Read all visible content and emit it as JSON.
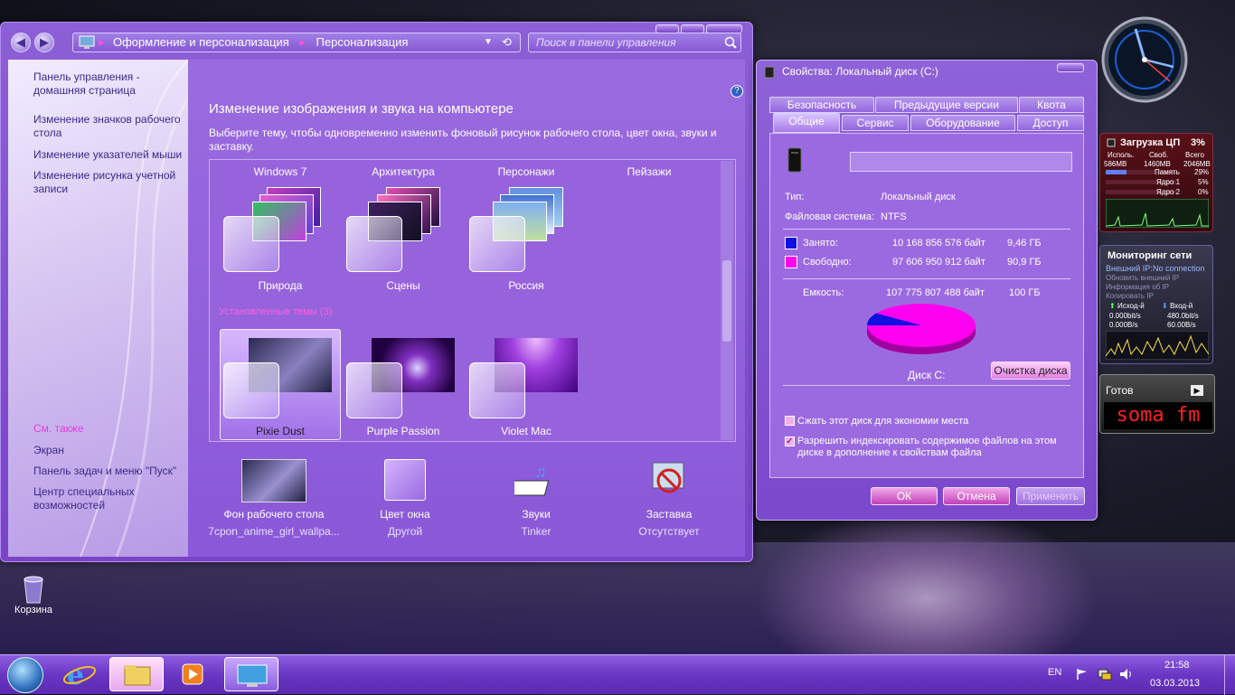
{
  "main_window": {
    "address_parts": [
      "Оформление и персонализация",
      "Персонализация"
    ],
    "search_placeholder": "Поиск в панели управления",
    "help_glyph": "?",
    "left_links": [
      "Панель управления - домашняя страница",
      "Изменение значков рабочего стола",
      "Изменение указателей мыши",
      "Изменение рисунка учетной записи"
    ],
    "see_also_heading": "См. также",
    "see_also_links": [
      "Экран",
      "Панель задач и меню \"Пуск\"",
      "Центр специальных возможностей"
    ],
    "heading": "Изменение изображения и звука на компьютере",
    "description": "Выберите тему, чтобы одновременно изменить фоновый рисунок рабочего стола, цвет окна, звуки и заставку.",
    "category_labels": [
      "Windows 7",
      "Архитектура",
      "Персонажи",
      "Пейзажи"
    ],
    "aero_themes": [
      "Природа",
      "Сцены",
      "Россия"
    ],
    "installed_heading": "Установленные темы (3)",
    "installed_themes": [
      "Pixie Dust",
      "Purple Passion",
      "Violet Mac"
    ],
    "selected_theme": "Pixie Dust",
    "bottom_items": [
      {
        "label": "Фон рабочего стола",
        "value": "7cpon_anime_girl_wallpa..."
      },
      {
        "label": "Цвет окна",
        "value": "Другой"
      },
      {
        "label": "Звуки",
        "value": "Tinker"
      },
      {
        "label": "Заставка",
        "value": "Отсутствует"
      }
    ]
  },
  "properties_dialog": {
    "title": "Свойства: Локальный диск (C:)",
    "tabs_row1": [
      "Безопасность",
      "Предыдущие версии",
      "Квота"
    ],
    "tabs_row2": [
      "Общие",
      "Сервис",
      "Оборудование",
      "Доступ"
    ],
    "active_tab": "Общие",
    "label_value": "",
    "type_label": "Тип:",
    "type_value": "Локальный диск",
    "fs_label": "Файловая система:",
    "fs_value": "NTFS",
    "used_label": "Занято:",
    "used_bytes": "10 168 856 576 байт",
    "used_gb": "9,46 ГБ",
    "free_label": "Свободно:",
    "free_bytes": "97 606 950 912 байт",
    "free_gb": "90,9 ГБ",
    "capacity_label": "Емкость:",
    "capacity_bytes": "107 775 807 488 байт",
    "capacity_gb": "100 ГБ",
    "used_color": "#1010e0",
    "free_color": "#ff00f0",
    "used_fraction": 0.094,
    "disk_label": "Диск C:",
    "cleanup_button": "Очистка диска",
    "compress_label": "Сжать этот диск для экономии места",
    "compress_checked": false,
    "index_label": "Разрешить индексировать содержимое файлов на этом диске в дополнение к свойствам файла",
    "index_checked": true,
    "ok": "ОК",
    "cancel": "Отмена",
    "apply": "Применить"
  },
  "gadgets": {
    "cpu": {
      "title": "Загрузка ЦП",
      "percent": "3%",
      "col_headers": [
        "Исполь.",
        "Своб.",
        "Всего"
      ],
      "col_values": [
        "586MB",
        "1460MB",
        "2046MB"
      ],
      "rows": [
        {
          "label": "Память",
          "value": "29%"
        },
        {
          "label": "Ядро 1",
          "value": "5%"
        },
        {
          "label": "Ядро 2",
          "value": "0%"
        }
      ]
    },
    "network": {
      "title": "Мониторинг сети",
      "external_ip_label": "Внешний IP:",
      "external_ip_value": "No connection",
      "links": [
        "Обновить внешний IP",
        "Информация об IP",
        "Копировать IP"
      ],
      "out_label": "Исход-й",
      "in_label": "Вход-й",
      "out_values": [
        "0.000bit/s",
        "0.000B/s"
      ],
      "in_values": [
        "480.0bit/s",
        "60.00B/s"
      ]
    },
    "radio": {
      "status": "Готов",
      "station": "soma fm"
    }
  },
  "desktop": {
    "recycle_bin": "Корзина"
  },
  "taskbar": {
    "language": "EN",
    "time": "21:58",
    "date": "03.03.2013"
  },
  "icons": [
    "back-icon",
    "forward-icon",
    "control-panel-icon",
    "search-icon",
    "help-icon",
    "drive-icon",
    "start-orb-icon",
    "ie-icon",
    "explorer-icon",
    "media-player-icon",
    "remote-desktop-icon",
    "flag-icon",
    "network-icon",
    "volume-icon",
    "recycle-bin-icon",
    "play-icon"
  ]
}
